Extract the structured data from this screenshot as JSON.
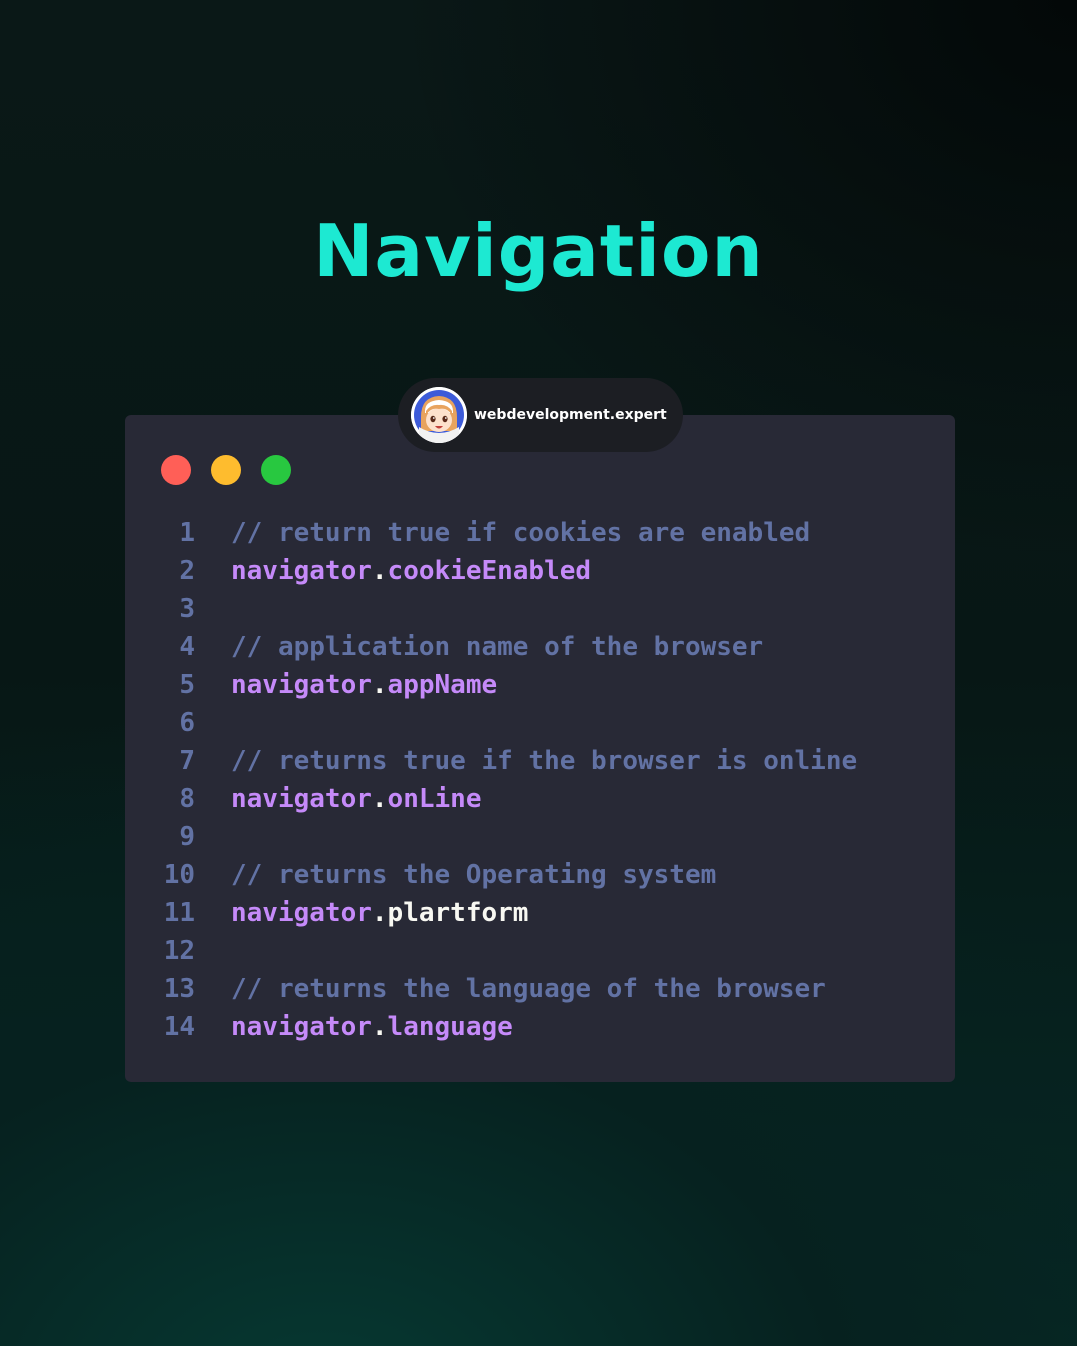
{
  "title": "Navigation",
  "badge": {
    "handle": "webdevelopment.expert",
    "avatar_icon": "anime-avatar-icon"
  },
  "window_controls": {
    "close_color": "#ff5f57",
    "minimize_color": "#febc2e",
    "maximize_color": "#28c840"
  },
  "code_lines": [
    {
      "number": "1",
      "kind": "comment",
      "text": "// return true if cookies are enabled"
    },
    {
      "number": "2",
      "kind": "code",
      "object": "navigator",
      "dot": ".",
      "property": "cookieEnabled"
    },
    {
      "number": "3",
      "kind": "blank",
      "text": ""
    },
    {
      "number": "4",
      "kind": "comment",
      "text": "// application name of the browser"
    },
    {
      "number": "5",
      "kind": "code",
      "object": "navigator",
      "dot": ".",
      "property": "appName"
    },
    {
      "number": "6",
      "kind": "blank",
      "text": ""
    },
    {
      "number": "7",
      "kind": "comment",
      "text": "// returns true if the browser is online"
    },
    {
      "number": "8",
      "kind": "code",
      "object": "navigator",
      "dot": ".",
      "property": "onLine"
    },
    {
      "number": "9",
      "kind": "blank",
      "text": ""
    },
    {
      "number": "10",
      "kind": "comment",
      "text": "// returns the Operating system"
    },
    {
      "number": "11",
      "kind": "code",
      "object": "navigator",
      "dot": ".",
      "property": "plartform"
    },
    {
      "number": "12",
      "kind": "blank",
      "text": ""
    },
    {
      "number": "13",
      "kind": "comment",
      "text": "// returns the language of the browser"
    },
    {
      "number": "14",
      "kind": "code",
      "object": "navigator",
      "dot": ".",
      "property": "language"
    }
  ],
  "colors": {
    "title": "#1de9d2",
    "comment": "#6272a4",
    "object": "#c58af9",
    "punctuation": "#f8f8f2",
    "card_background": "#282936"
  }
}
